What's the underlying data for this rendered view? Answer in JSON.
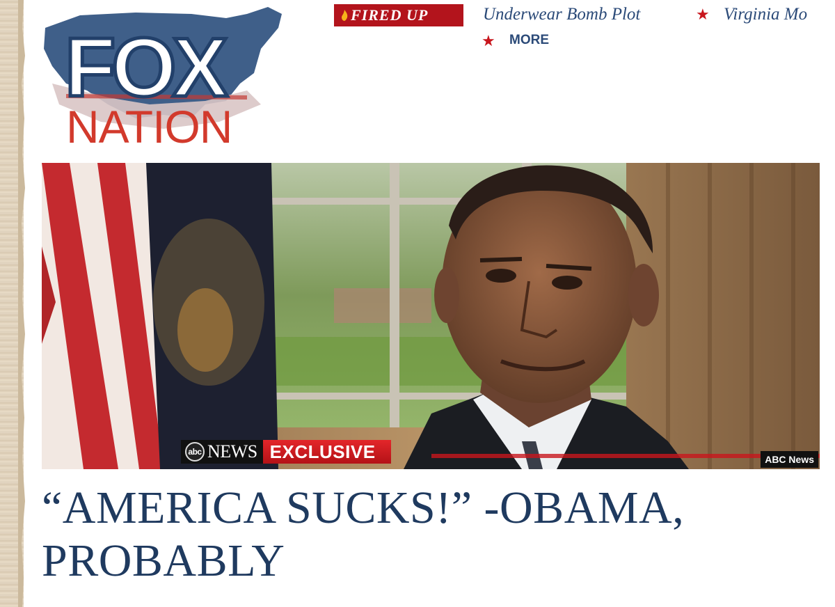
{
  "logo": {
    "top_word": "FOX",
    "bottom_word": "NATION",
    "colors": {
      "navy": "#22406a",
      "red": "#d23a2c",
      "map_blue": "#3f5f89"
    }
  },
  "nav": {
    "section_label": "FIRED UP",
    "section_icon": "flame-icon",
    "links": [
      "Underwear Bomb Plot",
      "Virginia Mo"
    ],
    "more_label": "MORE",
    "colors": {
      "section_bg": "#b3141c",
      "link": "#2b4a78",
      "star": "#c8161d"
    }
  },
  "photo": {
    "subject": "man in suit seated in office, flag left, window and curtains behind",
    "banner_brand": "NEWS",
    "banner_bug": "abc",
    "banner_tag": "EXCLUSIVE",
    "credit": "ABC News"
  },
  "headline": {
    "line1": "“AMERICA SUCKS!” -OBAMA,",
    "line2": "PROBABLY",
    "color": "#1f3a5f"
  }
}
